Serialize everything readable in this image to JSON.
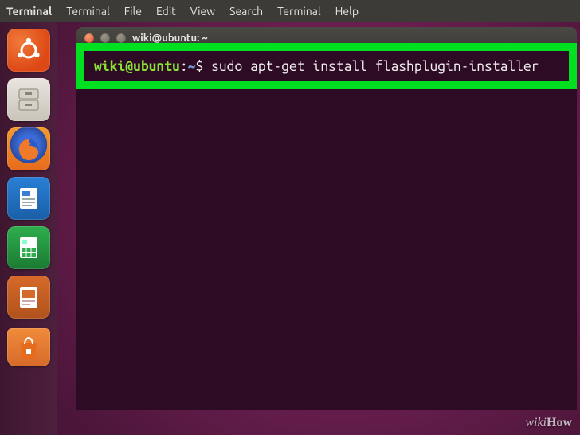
{
  "menubar": {
    "app_name": "Terminal",
    "items": [
      "Terminal",
      "File",
      "Edit",
      "View",
      "Search",
      "Terminal",
      "Help"
    ]
  },
  "launcher": {
    "items": [
      {
        "name": "dash",
        "label": "Dash"
      },
      {
        "name": "files",
        "label": "Files"
      },
      {
        "name": "firefox",
        "label": "Firefox"
      },
      {
        "name": "writer",
        "label": "LibreOffice Writer"
      },
      {
        "name": "calc",
        "label": "LibreOffice Calc"
      },
      {
        "name": "impress",
        "label": "LibreOffice Impress"
      },
      {
        "name": "software",
        "label": "Ubuntu Software"
      }
    ]
  },
  "window": {
    "title": "wiki@ubuntu: ~"
  },
  "prompt": {
    "user": "wiki",
    "at": "@",
    "host": "ubuntu",
    "colon": ":",
    "path": "~",
    "dollar": "$ "
  },
  "command": "sudo apt-get install flashplugin-installer",
  "watermark_prefix": "wiki",
  "watermark_suffix": "How",
  "colors": {
    "highlight": "#00e020",
    "term_bg": "#2e0b24",
    "prompt_user": "#8ae234",
    "prompt_path": "#729fcf"
  }
}
